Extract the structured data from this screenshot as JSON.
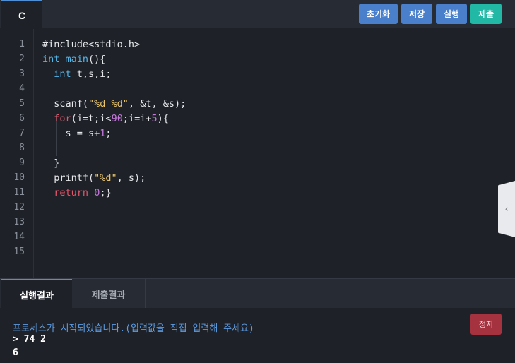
{
  "topbar": {
    "lang_tab": "C",
    "buttons": {
      "reset": "초기화",
      "save": "저장",
      "run": "실행",
      "submit": "제출"
    }
  },
  "editor": {
    "line_numbers": [
      "1",
      "2",
      "3",
      "4",
      "5",
      "6",
      "7",
      "8",
      "9",
      "10",
      "11",
      "12",
      "13",
      "14",
      "15"
    ],
    "code": [
      "#include<stdio.h>",
      "int main(){",
      "  int t,s,i;",
      "",
      "  scanf(\"%d %d\", &t, &s);",
      "  for(i=t;i<90;i=i+5){",
      "    s = s+1;",
      "",
      "  }",
      "  printf(\"%d\", s);",
      "  return 0;}",
      "",
      "",
      "",
      ""
    ]
  },
  "result": {
    "tabs": {
      "run_result": "실행결과",
      "submit_result": "제출결과"
    },
    "stop_label": "정지",
    "output_lines": [
      "프로세스가 시작되었습니다.(입력값을 직접 입력해 주세요)",
      "> 74 2",
      "6"
    ]
  },
  "colors": {
    "accent": "#4a7fcb",
    "submit": "#22b8a6",
    "stop": "#a4323f"
  }
}
